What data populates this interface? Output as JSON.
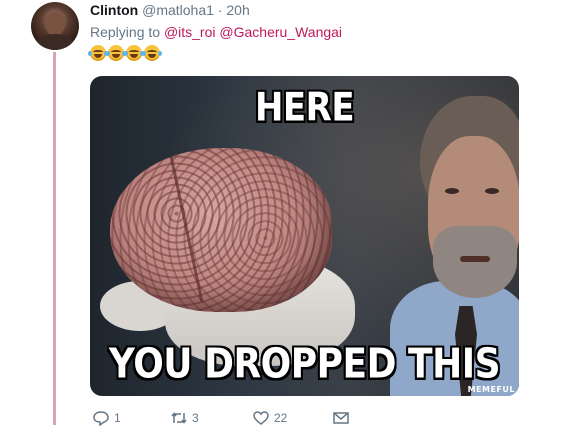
{
  "tweet": {
    "author_name": "Clinton",
    "author_handle": "@matloha1",
    "separator": "·",
    "timestamp": "20h",
    "reply_prefix": "Replying to",
    "mentions": [
      "@its_roi",
      "@Gacheru_Wangai"
    ],
    "emoji_icons": [
      "face-with-tears-of-joy-icon",
      "face-with-tears-of-joy-icon",
      "face-with-tears-of-joy-icon",
      "face-with-tears-of-joy-icon"
    ]
  },
  "media": {
    "top_text": "HERE",
    "bottom_text": "YOU DROPPED THIS",
    "watermark": "MEMEFUL"
  },
  "actions": {
    "reply_count": "1",
    "retweet_count": "3",
    "like_count": "22",
    "icons": [
      "comment-icon",
      "retweet-icon",
      "heart-icon",
      "message-icon"
    ]
  },
  "colors": {
    "thread_line": "#d9a4b3",
    "mention": "#c2185b",
    "muted_text": "#657786"
  }
}
